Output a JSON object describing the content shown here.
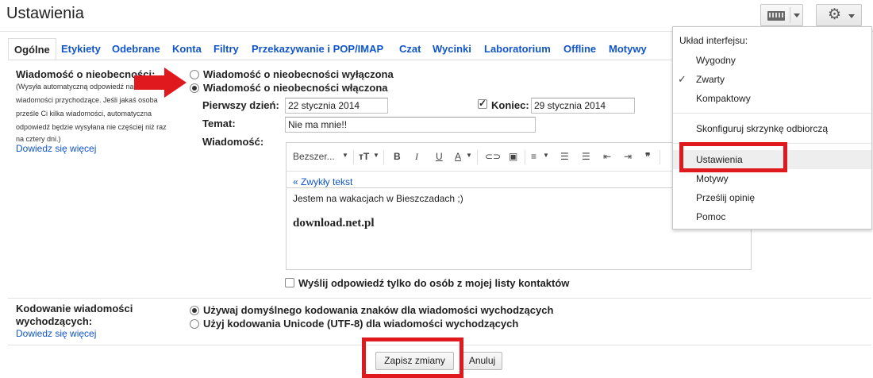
{
  "header": {
    "title": "Ustawienia"
  },
  "tabs": [
    {
      "label": "Ogólne",
      "active": true
    },
    {
      "label": "Etykiety"
    },
    {
      "label": "Odebrane"
    },
    {
      "label": "Konta"
    },
    {
      "label": "Filtry"
    },
    {
      "label": "Przekazywanie i POP/IMAP"
    },
    {
      "label": "Czat"
    },
    {
      "label": "Wycinki"
    },
    {
      "label": "Laboratorium"
    },
    {
      "label": "Offline"
    },
    {
      "label": "Motywy"
    }
  ],
  "vacation": {
    "label": "Wiadomość o nieobecności:",
    "help": [
      "(Wysyła automatyczną odpowiedź na",
      "wiadomości przychodzące. Jeśli jakaś osoba",
      "prześle Ci kilka wiadomości, automatyczna",
      "odpowiedź będzie wysyłana nie częściej niż raz",
      "na cztery dni.)"
    ],
    "learn_more": "Dowiedz się więcej",
    "option_off": "Wiadomość o nieobecności wyłączona",
    "option_on": "Wiadomość o nieobecności włączona",
    "selected": "on",
    "first_day_label": "Pierwszy dzień:",
    "first_day_value": "22 stycznia 2014",
    "end_label": "Koniec:",
    "end_checked": true,
    "end_value": "29 stycznia 2014",
    "subject_label": "Temat:",
    "subject_value": "Nie ma mnie!!",
    "message_label": "Wiadomość:",
    "font_name": "Bezszer...",
    "plain_text_link": "« Zwykły tekst",
    "body_line1": "Jestem na wakacjach w Bieszczadach ;)",
    "body_line2": "download.net.pl",
    "contacts_only_label": "Wyślij odpowiedź tylko do osób z mojej listy kontaktów",
    "contacts_only_checked": false
  },
  "encoding": {
    "label_line1": "Kodowanie wiadomości",
    "label_line2": "wychodzących:",
    "learn_more": "Dowiedz się więcej",
    "option_default": "Używaj domyślnego kodowania znaków dla wiadomości wychodzących",
    "option_unicode": "Użyj kodowania Unicode (UTF-8) dla wiadomości wychodzących",
    "selected": "default"
  },
  "buttons": {
    "save": "Zapisz zmiany",
    "cancel": "Anuluj"
  },
  "settings_menu": {
    "header": "Układ interfejsu:",
    "density": [
      "Wygodny",
      "Zwarty",
      "Kompaktowy"
    ],
    "density_selected": "Zwarty",
    "configure_inbox": "Skonfiguruj skrzynkę odbiorczą",
    "settings": "Ustawienia",
    "themes": "Motywy",
    "feedback": "Prześlij opinię",
    "help": "Pomoc"
  },
  "colors": {
    "link": "#1155cc",
    "highlight": "#e0191f"
  }
}
